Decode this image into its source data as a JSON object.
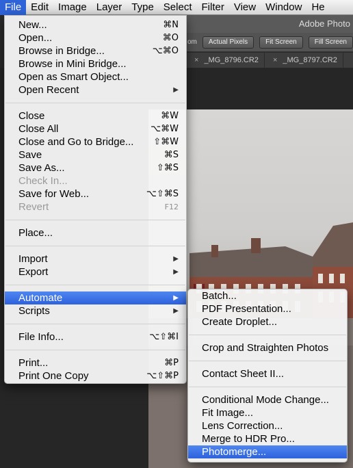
{
  "menubar": {
    "items": [
      "File",
      "Edit",
      "Image",
      "Layer",
      "Type",
      "Select",
      "Filter",
      "View",
      "Window",
      "He"
    ]
  },
  "ps": {
    "app_title": "Adobe Photo",
    "zoom_fragment": "om",
    "buttons": [
      "Actual Pixels",
      "Fit Screen",
      "Fill Screen"
    ],
    "tabs": [
      "_MG_8796.CR2",
      "_MG_8797.CR2"
    ]
  },
  "file_menu": {
    "groups": [
      [
        {
          "label": "New...",
          "shortcut": "⌘N"
        },
        {
          "label": "Open...",
          "shortcut": "⌘O"
        },
        {
          "label": "Browse in Bridge...",
          "shortcut": "⌥⌘O"
        },
        {
          "label": "Browse in Mini Bridge...",
          "shortcut": ""
        },
        {
          "label": "Open as Smart Object...",
          "shortcut": ""
        },
        {
          "label": "Open Recent",
          "shortcut": "",
          "submenu": true
        }
      ],
      [
        {
          "label": "Close",
          "shortcut": "⌘W"
        },
        {
          "label": "Close All",
          "shortcut": "⌥⌘W"
        },
        {
          "label": "Close and Go to Bridge...",
          "shortcut": "⇧⌘W"
        },
        {
          "label": "Save",
          "shortcut": "⌘S"
        },
        {
          "label": "Save As...",
          "shortcut": "⇧⌘S"
        },
        {
          "label": "Check In...",
          "shortcut": "",
          "disabled": true
        },
        {
          "label": "Save for Web...",
          "shortcut": "⌥⇧⌘S"
        },
        {
          "label": "Revert",
          "shortcut": "F12",
          "disabled": true
        }
      ],
      [
        {
          "label": "Place...",
          "shortcut": ""
        }
      ],
      [
        {
          "label": "Import",
          "shortcut": "",
          "submenu": true
        },
        {
          "label": "Export",
          "shortcut": "",
          "submenu": true
        }
      ],
      [
        {
          "label": "Automate",
          "shortcut": "",
          "submenu": true,
          "highlight": true
        },
        {
          "label": "Scripts",
          "shortcut": "",
          "submenu": true
        }
      ],
      [
        {
          "label": "File Info...",
          "shortcut": "⌥⇧⌘I"
        }
      ],
      [
        {
          "label": "Print...",
          "shortcut": "⌘P"
        },
        {
          "label": "Print One Copy",
          "shortcut": "⌥⇧⌘P"
        }
      ]
    ]
  },
  "automate_menu": {
    "groups": [
      [
        {
          "label": "Batch..."
        },
        {
          "label": "PDF Presentation..."
        },
        {
          "label": "Create Droplet..."
        }
      ],
      [
        {
          "label": "Crop and Straighten Photos"
        }
      ],
      [
        {
          "label": "Contact Sheet II..."
        }
      ],
      [
        {
          "label": "Conditional Mode Change..."
        },
        {
          "label": "Fit Image..."
        },
        {
          "label": "Lens Correction..."
        },
        {
          "label": "Merge to HDR Pro..."
        },
        {
          "label": "Photomerge...",
          "highlight": true
        }
      ]
    ]
  },
  "icons": {
    "submenu_arrow": "▶",
    "close_tab": "×"
  },
  "colors": {
    "highlight": "#2d62dc",
    "menu_bg": "#f5f5f5"
  }
}
